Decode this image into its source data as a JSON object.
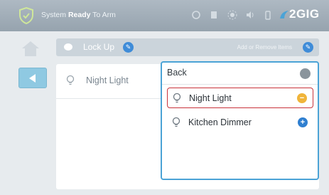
{
  "statusbar": {
    "status_prefix": "System",
    "status_bold": "Ready",
    "status_suffix": " To Arm",
    "brand": "2GIG",
    "icons": [
      "shield-check-icon",
      "refresh-icon",
      "bookmark-icon",
      "brightness-icon",
      "volume-icon",
      "battery-icon"
    ]
  },
  "header": {
    "title": "Lock Up",
    "add_remove": "Add or Remove Items"
  },
  "devices": [
    {
      "label": "Night Light",
      "icon": "lightbulb-icon"
    }
  ],
  "popup": {
    "back_label": "Back",
    "items": [
      {
        "label": "Night Light",
        "action": "remove",
        "symbol": "−",
        "selected": true
      },
      {
        "label": "Kitchen Dimmer",
        "action": "add",
        "symbol": "+",
        "selected": false
      }
    ]
  },
  "colors": {
    "topbar": "#a4b0bb",
    "accent_blue": "#4ba3d6",
    "remove_orange": "#f0b43a",
    "add_blue": "#2f7fd0",
    "selected_border": "#c9333b"
  }
}
